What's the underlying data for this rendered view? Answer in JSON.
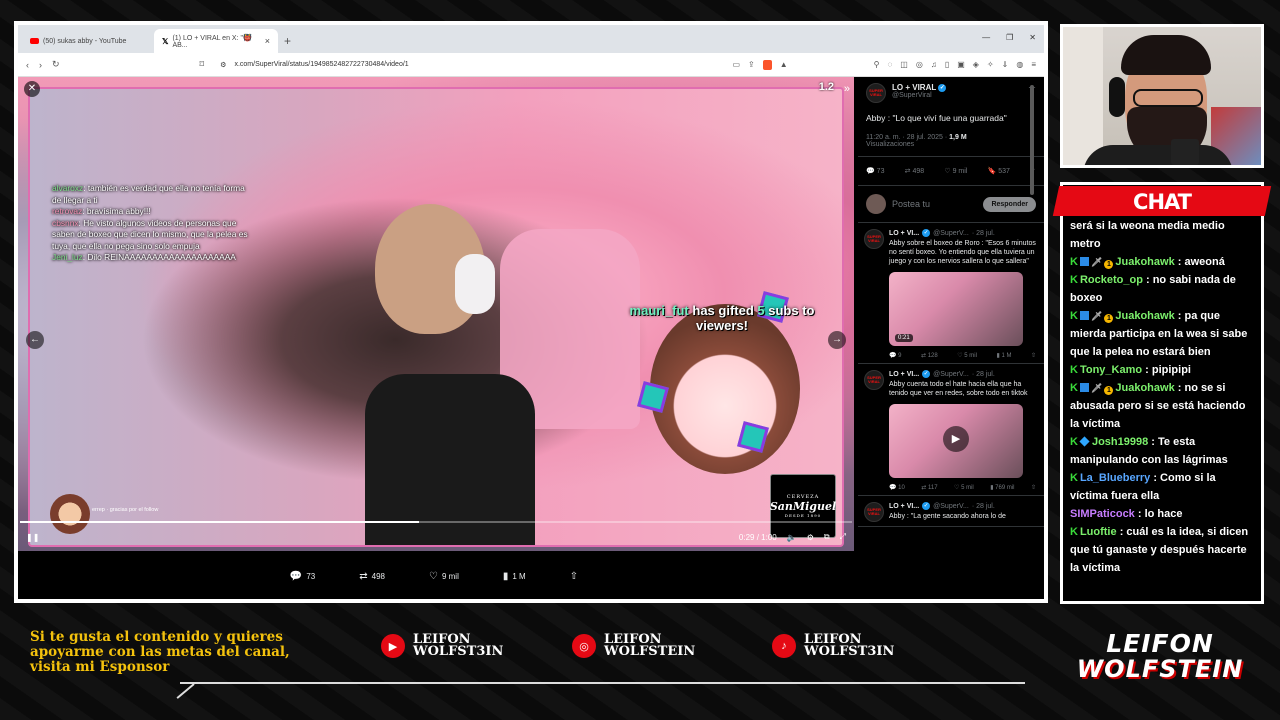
{
  "browser": {
    "tabs": [
      {
        "label": "(50) sukas abby - YouTube",
        "active": false
      },
      {
        "label": "(1) LO + VIRAL en X: \"👹 AB...",
        "active": true
      }
    ],
    "url": "x.com/SuperViral/status/1949852482722730484/video/1"
  },
  "video": {
    "top_right": "1.2",
    "chat_overlay": [
      {
        "user": "alvaroxz",
        "text": ": también es verdad que ella no tenía forma de llegar a ti"
      },
      {
        "user": "retrovaz",
        "text": ": bravísima abby!!!"
      },
      {
        "user": "cbsnnx",
        "text": ": He visto algunos videos de personas que saben de boxeo que dicen lo mismo, que la pelea es tuya, que ella no pega sino solo empuja"
      },
      {
        "user": "Jeni_luz",
        "text": ": Dilo REINAAAAAAAAAAAAAAAAAAAA"
      }
    ],
    "gift_user": "mauri_fut",
    "gift_mid": " has gifted ",
    "gift_count": "5",
    "gift_end": " subs to viewers!",
    "sponsor_small": "CERVEZA",
    "sponsor_brand": "SanMiguel",
    "sponsor_sub": "DESDE 1890",
    "mini_chat_user": "errep",
    "mini_chat_text": "gracias por el follow",
    "progress_fraction": 0.48,
    "time": "0:29 / 1:00",
    "actions": {
      "replies": "73",
      "reposts": "498",
      "likes": "9 mil",
      "views": "1 M"
    }
  },
  "tweet": {
    "name": "LO + VIRAL",
    "handle": "@SuperViral",
    "text": "Abby : \"Lo que viví fue una guarrada\"",
    "time": "11:20 a. m. · 28 jul. 2025 · ",
    "views_count": "1,9 M",
    "views_label": "Visualizaciones",
    "stats": {
      "replies": "73",
      "reposts": "498",
      "likes": "9 mil",
      "bookmarks": "537"
    },
    "reply_placeholder": "Postea tu",
    "reply_button": "Responder"
  },
  "posts": [
    {
      "name": "LO + VI...",
      "handle": "@SuperV...",
      "date": "· 28 jul.",
      "text": "Abby sobre el boxeo de Roro : \"Esos 6 minutos no sentí boxeo. Yo entiendo que ella tuviera un juego y con los nervios sallera lo que sallera\"",
      "duration": "0:21",
      "stats": {
        "replies": "9",
        "reposts": "128",
        "likes": "5 mil",
        "views": "1 M"
      }
    },
    {
      "name": "LO + VI...",
      "handle": "@SuperV...",
      "date": "· 28 jul.",
      "text": "Abby cuenta todo el hate hacia ella que ha tenido que ver en redes, sobre todo en tiktok",
      "duration": "",
      "stats": {
        "replies": "10",
        "reposts": "117",
        "likes": "5 mil",
        "views": "769 mil"
      }
    },
    {
      "name": "LO + VI...",
      "handle": "@SuperV...",
      "date": "· 28 jul.",
      "text": "Abby : \"La gente sacando ahora lo de"
    }
  ],
  "chat": {
    "title": "CHAT",
    "messages": [
      {
        "badges": "",
        "user": "",
        "ucls": "",
        "text": "será si la weona media medio metro"
      },
      {
        "badges": "kbsc",
        "user": "Juakohawk",
        "ucls": "u-g",
        "text": ": aweoná"
      },
      {
        "badges": "k",
        "user": "Rocketo_op",
        "ucls": "u-g",
        "text": ": no sabi nada de boxeo"
      },
      {
        "badges": "kbsc",
        "user": "Juakohawk",
        "ucls": "u-g",
        "text": ": pa que mierda participa en la wea si sabe que la pelea no estará bien"
      },
      {
        "badges": "k",
        "user": "Tony_Kamo",
        "ucls": "u-g",
        "text": ": pipipipi"
      },
      {
        "badges": "kbsc",
        "user": "Juakohawk",
        "ucls": "u-g",
        "text": ": no se si abusada pero si se está haciendo la víctima"
      },
      {
        "badges": "kh",
        "user": "Josh19998",
        "ucls": "u-g",
        "text": ": Te esta manipulando con las lágrimas"
      },
      {
        "badges": "k",
        "user": "La_Blueberry",
        "ucls": "u-b",
        "text": ": Como si la víctima fuera ella"
      },
      {
        "badges": "",
        "user": "SIMPaticock",
        "ucls": "u-p",
        "text": ": lo hace"
      },
      {
        "badges": "k",
        "user": "Luoftie",
        "ucls": "u-g",
        "text": ": cuál es la idea, si dicen que tú ganaste y después hacerte la víctima"
      }
    ]
  },
  "footer": {
    "cta": "Si te gusta el contenido y quieres apoyarme con las metas del canal, visita mi Esponsor",
    "socials": [
      {
        "icon": "youtube-icon",
        "line1": "LEIFON",
        "line2": "WOLFST3IN"
      },
      {
        "icon": "instagram-icon",
        "line1": "LEIFON",
        "line2": "WOLFSTEIN"
      },
      {
        "icon": "tiktok-icon",
        "line1": "LEIFON",
        "line2": "WOLFST3IN"
      }
    ],
    "logo_top": "LEIFON",
    "logo_bottom": "WOLFSTEIN"
  },
  "colors": {
    "accent": "#e50914",
    "yellow": "#f4c20d",
    "twitter_blue": "#1d9bf0"
  }
}
